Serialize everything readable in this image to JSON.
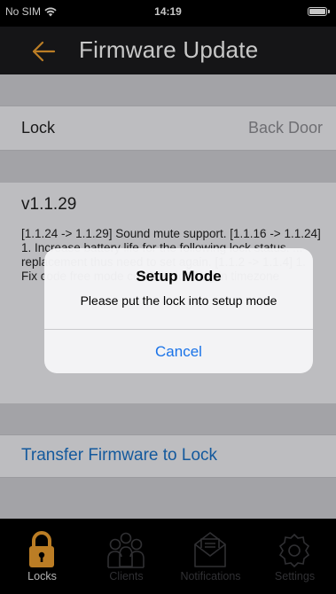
{
  "status_bar": {
    "carrier": "No SIM",
    "time": "14:19"
  },
  "header": {
    "title": "Firmware Update",
    "back_icon": "back-arrow-icon",
    "accent": "#f0a030"
  },
  "lock_row": {
    "label": "Lock",
    "value": "Back Door"
  },
  "release_notes": {
    "version": "v1.1.29",
    "text": "[1.1.24 -> 1.1.29] Sound mute support. [1.1.16 -> 1.1.24] 1. Increase battery life for the following lock status. ... replacement thus need to set again. [1.1.2 -> 1.1.4] 1. Fix code free mode combination bug in timezone"
  },
  "transfer_label": "Transfer Firmware to Lock",
  "alert": {
    "title": "Setup Mode",
    "message": "Please put the lock into setup mode",
    "cancel_label": "Cancel"
  },
  "tabs": [
    {
      "label": "Locks",
      "icon": "lock-icon",
      "active": true
    },
    {
      "label": "Clients",
      "icon": "users-icon",
      "active": false
    },
    {
      "label": "Notifications",
      "icon": "envelope-icon",
      "active": false
    },
    {
      "label": "Settings",
      "icon": "gear-icon",
      "active": false
    }
  ],
  "colors": {
    "link": "#1a73c9",
    "tab_active": "#f0a030",
    "tab_inactive": "#3e3e42"
  }
}
